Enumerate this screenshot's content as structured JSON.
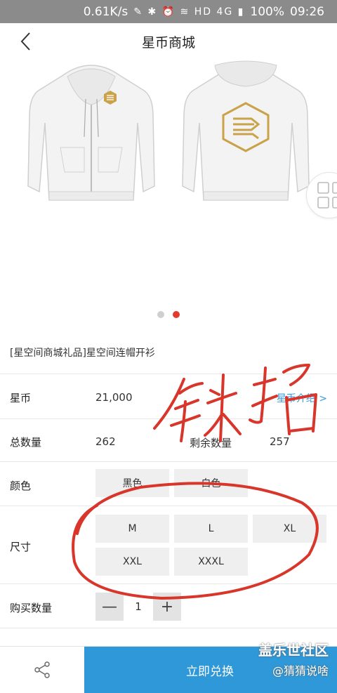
{
  "status_bar": {
    "speed": "0.61K/s",
    "icons": "✎ ✱ ⏰ ≋ HD 4G ▮",
    "battery": "100%",
    "time": "09:26"
  },
  "header": {
    "title": "星币商城"
  },
  "product": {
    "name": "[星空间商城礼品]星空间连帽开衫",
    "image_dots": 2,
    "active_dot": 1
  },
  "rows": {
    "coins": {
      "label": "星币",
      "value": "21,000",
      "link": "星币介绍 >"
    },
    "stock": {
      "label": "总数量",
      "total": "262",
      "remaining_label": "剩余数量",
      "remaining": "257"
    },
    "color": {
      "label": "颜色",
      "options": [
        "黑色",
        "白色"
      ]
    },
    "size": {
      "label": "尺寸",
      "options": [
        "M",
        "L",
        "XL",
        "XXL",
        "XXXL"
      ]
    },
    "quantity": {
      "label": "购买数量",
      "minus": "—",
      "value": "1",
      "plus": "+"
    }
  },
  "bottom": {
    "buy_label": "立即兑换"
  },
  "watermark": {
    "line1": "盖乐世社区",
    "line2": "@猜猜说啥"
  },
  "colors": {
    "accent": "#2f98d8",
    "dot_active": "#e23a2f",
    "annotation": "#d8362b",
    "logo_gold": "#c9a24a"
  }
}
